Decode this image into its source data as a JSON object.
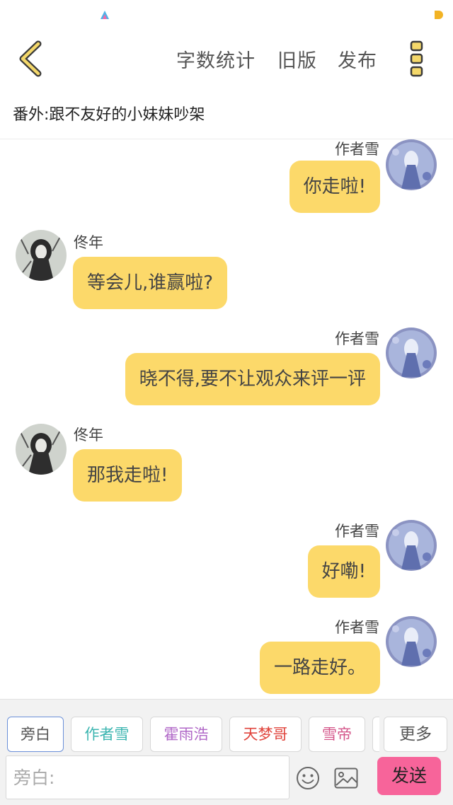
{
  "header": {
    "word_count": "字数统计",
    "old_version": "旧版",
    "publish": "发布"
  },
  "chapter": {
    "title": "番外:跟不友好的小妹妹吵架"
  },
  "messages": [
    {
      "side": "right",
      "sender": "作者雪",
      "text": "你走啦!"
    },
    {
      "side": "left",
      "sender": "佟年",
      "text": "等会儿,谁赢啦?"
    },
    {
      "side": "right",
      "sender": "作者雪",
      "text": "晓不得,要不让观众来评一评"
    },
    {
      "side": "left",
      "sender": "佟年",
      "text": "那我走啦!"
    },
    {
      "side": "right",
      "sender": "作者雪",
      "text": "好嘞!"
    },
    {
      "side": "right",
      "sender": "作者雪",
      "text": "一路走好。"
    }
  ],
  "characters": [
    {
      "name": "旁白",
      "color": "#555555"
    },
    {
      "name": "作者雪",
      "color": "#3bb5b0"
    },
    {
      "name": "霍雨浩",
      "color": "#b067c7"
    },
    {
      "name": "天梦哥",
      "color": "#e0443c"
    },
    {
      "name": "雪帝",
      "color": "#d4568a"
    }
  ],
  "more_label": "更多",
  "input": {
    "placeholder": "旁白:",
    "value": ""
  },
  "send_label": "发送",
  "colors": {
    "bubble": "#fcd96a",
    "accent_yellow": "#f2b324",
    "send": "#f7649a"
  }
}
